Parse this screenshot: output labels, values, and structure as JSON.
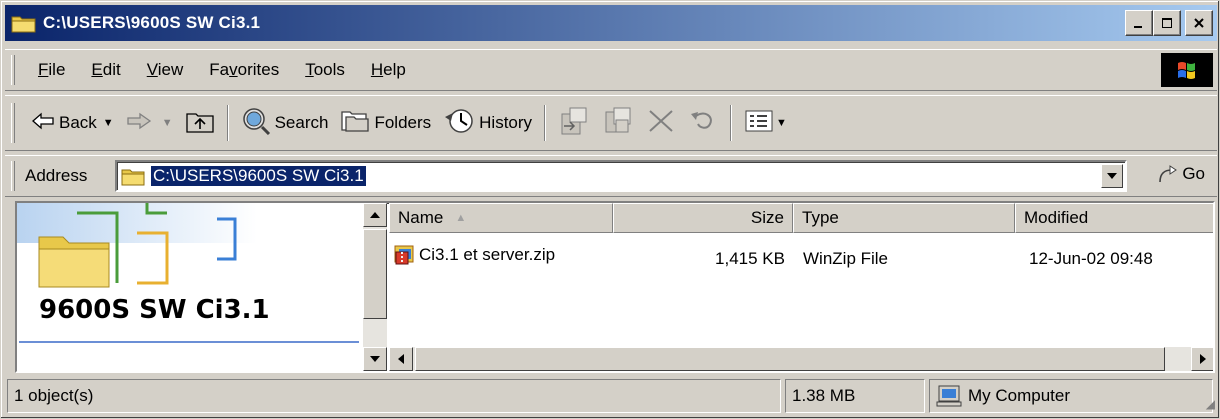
{
  "window": {
    "title": "C:\\USERS\\9600S SW Ci3.1",
    "controls": {
      "minimize": "_",
      "maximize": "□",
      "close": "×"
    }
  },
  "menu": [
    {
      "label": "File",
      "hotkey_index": 0
    },
    {
      "label": "Edit",
      "hotkey_index": 0
    },
    {
      "label": "View",
      "hotkey_index": 0
    },
    {
      "label": "Favorites",
      "hotkey_index": 2
    },
    {
      "label": "Tools",
      "hotkey_index": 0
    },
    {
      "label": "Help",
      "hotkey_index": 0
    }
  ],
  "toolbar": {
    "back_label": "Back",
    "search_label": "Search",
    "folders_label": "Folders",
    "history_label": "History",
    "icons": [
      "back-arrow-icon",
      "forward-arrow-icon",
      "up-folder-icon",
      "search-icon",
      "folders-icon",
      "history-icon",
      "move-to-icon",
      "copy-to-icon",
      "delete-icon",
      "undo-icon",
      "views-icon"
    ]
  },
  "address": {
    "label": "Address",
    "value": "C:\\USERS\\9600S SW Ci3.1",
    "go_label": "Go"
  },
  "left_pane": {
    "folder_name": "9600S SW Ci3.1"
  },
  "list": {
    "columns": [
      "Name",
      "Size",
      "Type",
      "Modified"
    ],
    "sort_indicator": "▲",
    "rows": [
      {
        "name": "Ci3.1 et server.zip",
        "size": "1,415 KB",
        "type": "WinZip File",
        "modified": "12-Jun-02 09:48"
      }
    ]
  },
  "status": {
    "objects": "1 object(s)",
    "size": "1.38 MB",
    "zone": "My Computer"
  },
  "colors": {
    "title_start": "#0a246a",
    "title_end": "#a6caf0",
    "face": "#d4d0c8",
    "selection": "#0a246a"
  }
}
